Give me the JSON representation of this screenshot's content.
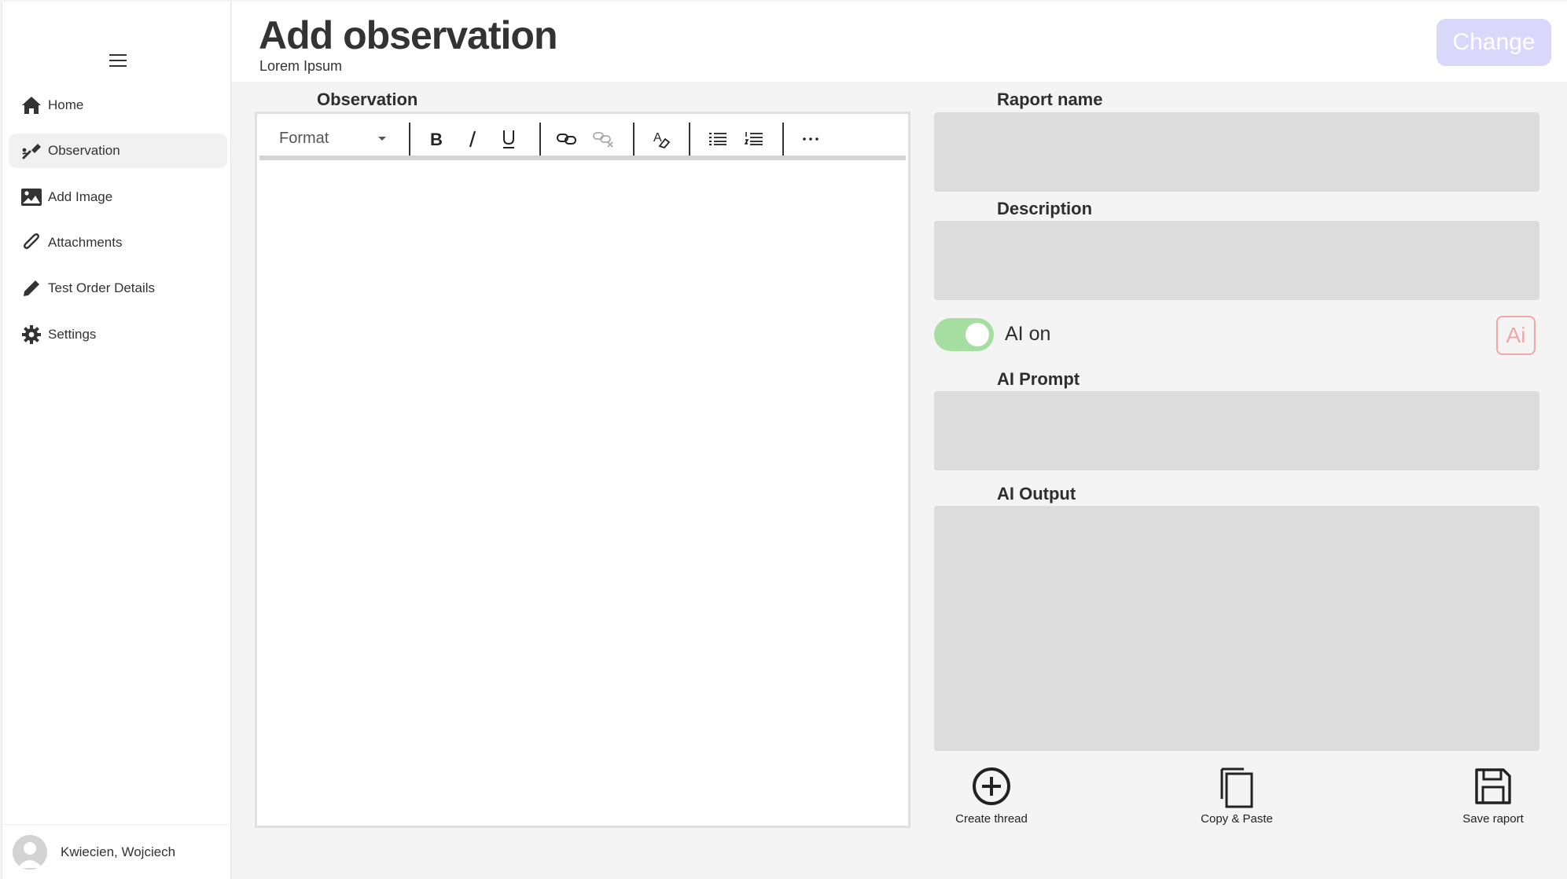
{
  "sidebar": {
    "menu_icon": "hamburger-icon",
    "items": [
      {
        "label": "Home",
        "icon": "home-icon"
      },
      {
        "label": "Observation",
        "icon": "observation-icon",
        "active": true
      },
      {
        "label": "Add Image",
        "icon": "image-icon"
      },
      {
        "label": "Attachments",
        "icon": "paperclip-icon"
      },
      {
        "label": "Test Order Details",
        "icon": "pencil-icon"
      },
      {
        "label": "Settings",
        "icon": "gear-icon"
      }
    ],
    "user": {
      "name": "Kwiecien, Wojciech",
      "icon": "avatar-icon"
    }
  },
  "header": {
    "title": "Add observation",
    "subtitle": "Lorem Ipsum",
    "change_label": "Change"
  },
  "editor": {
    "label": "Observation",
    "format_label": "Format",
    "tools": [
      "bold-icon",
      "italic-icon",
      "underline-icon",
      "link-icon",
      "unlink-icon",
      "clear-format-icon",
      "bullet-list-icon",
      "numbered-list-icon",
      "more-icon"
    ]
  },
  "form": {
    "raport_name_label": "Raport name",
    "description_label": "Description",
    "ai_toggle_label": "AI on",
    "ai_badge": "Ai",
    "ai_prompt_label": "AI Prompt",
    "ai_output_label": "AI Output"
  },
  "actions": {
    "create_thread": "Create thread",
    "copy_paste": "Copy & Paste",
    "save_raport": "Save raport"
  },
  "colors": {
    "accent_button": "#d9d8fb",
    "toggle_on": "#a6dea1",
    "ai_badge": "#f0a7a7",
    "field_bg": "#dcdcdc"
  }
}
